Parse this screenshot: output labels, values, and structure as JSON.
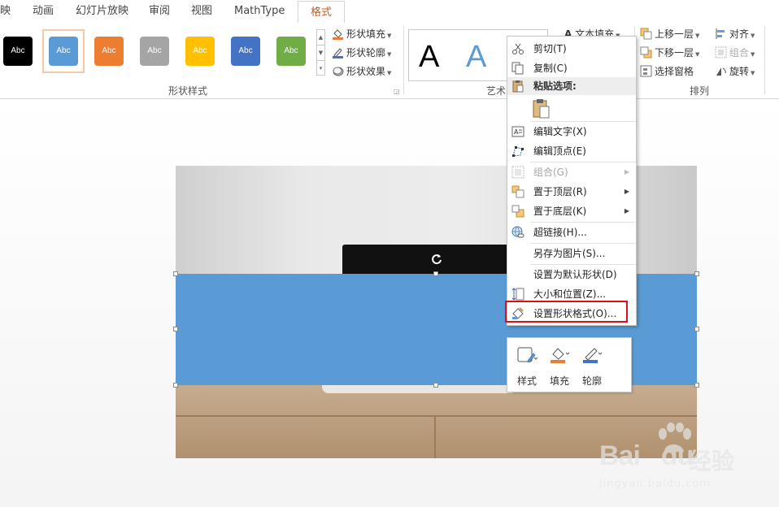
{
  "tabs": [
    {
      "label": "映",
      "id": "transition"
    },
    {
      "label": "动画",
      "id": "animation"
    },
    {
      "label": "幻灯片放映",
      "id": "slideshow"
    },
    {
      "label": "审阅",
      "id": "review"
    },
    {
      "label": "视图",
      "id": "view"
    },
    {
      "label": "MathType",
      "id": "mathtype"
    },
    {
      "label": "格式",
      "id": "format",
      "active": true
    }
  ],
  "ribbon": {
    "shape_styles": {
      "swatches": [
        {
          "label": "Abc",
          "color": "#000000"
        },
        {
          "label": "Abc",
          "color": "#5b9bd5"
        },
        {
          "label": "Abc",
          "color": "#ed7d31"
        },
        {
          "label": "Abc",
          "color": "#a5a5a5"
        },
        {
          "label": "Abc",
          "color": "#ffc000"
        },
        {
          "label": "Abc",
          "color": "#4472c4"
        },
        {
          "label": "Abc",
          "color": "#70ad47"
        }
      ],
      "fill_label": "形状填充",
      "outline_label": "形状轮廓",
      "effect_label": "形状效果",
      "group_label": "形状样式"
    },
    "wordart": {
      "samples": [
        "A",
        "A"
      ],
      "text_fill_label": "文本填充",
      "group_label": "艺术"
    },
    "arrange": {
      "bring_forward_label": "上移一层",
      "send_backward_label": "下移一层",
      "selection_pane_label": "选择窗格",
      "align_label": "对齐",
      "group_label_cmd": "组合",
      "rotate_label": "旋转",
      "group_label": "排列"
    }
  },
  "context_menu": {
    "cut": "剪切(T)",
    "copy": "复制(C)",
    "paste_header": "粘贴选项:",
    "edit_text": "编辑文字(X)",
    "edit_points": "编辑顶点(E)",
    "group": "组合(G)",
    "bring_to_front": "置于顶层(R)",
    "send_to_back": "置于底层(K)",
    "hyperlink": "超链接(H)...",
    "save_as_picture": "另存为图片(S)...",
    "set_default_shape": "设置为默认形状(D)",
    "size_position": "大小和位置(Z)...",
    "format_shape": "设置形状格式(O)..."
  },
  "mini_toolbar": {
    "style_label": "样式",
    "fill_label": "填充",
    "outline_label": "轮廓"
  },
  "watermark": {
    "brand": "Bai",
    "brand2": "du",
    "cn": "经验",
    "url": "jingyan.baidu.com"
  },
  "colors": {
    "accent_tab": "#c65b24",
    "shape_fill": "#5b9bd5",
    "highlight": "#d9101a"
  }
}
